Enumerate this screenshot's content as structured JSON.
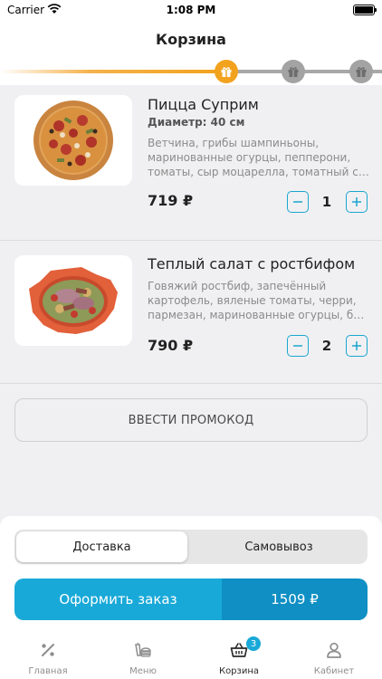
{
  "status_bar": {
    "carrier": "Carrier",
    "time": "1:08 PM"
  },
  "header": {
    "title": "Корзина"
  },
  "checkout_progress": {
    "current_step": 1,
    "total_steps": 3
  },
  "cart_items": [
    {
      "name": "Пицца Суприм",
      "diameter": "Диаметр: 40 см",
      "description_lines": [
        "Ветчина, грибы шампиньоны,",
        "маринованные огурцы, пепперони,",
        "томаты, сыр моцарелла, томатный со..."
      ],
      "price": "719 ₽",
      "quantity": "1"
    },
    {
      "name": "Теплый салат с ростбифом",
      "description_lines": [
        "Говяжий ростбиф, запечённый",
        "картофель, вяленые томаты, черри,",
        "пармезан, маринованные огурцы, ба..."
      ],
      "price": "790 ₽",
      "quantity": "2"
    }
  ],
  "promo": {
    "label": "ВВЕСТИ ПРОМОКОД"
  },
  "delivery_mode": {
    "options": [
      "Доставка",
      "Самовывоз"
    ],
    "selected": "Доставка"
  },
  "order": {
    "button_label": "Оформить заказ",
    "total": "1509 ₽"
  },
  "tabbar": {
    "tabs": [
      {
        "label": "Главная",
        "icon": "percent-icon"
      },
      {
        "label": "Меню",
        "icon": "menu-food-icon"
      },
      {
        "label": "Корзина",
        "icon": "basket-icon",
        "badge": "3",
        "active": true
      },
      {
        "label": "Кабинет",
        "icon": "person-icon"
      }
    ]
  },
  "colors": {
    "accent": "#18a9d8",
    "accent_dark": "#0f8fc4",
    "progress_orange": "#f2a21d",
    "inactive_gray": "#a3a3a3"
  }
}
